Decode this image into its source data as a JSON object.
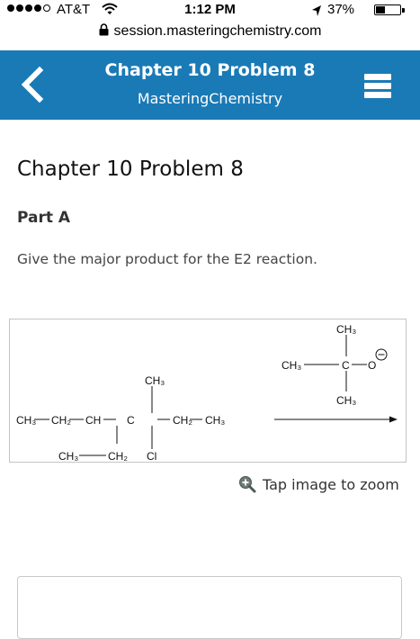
{
  "status_bar": {
    "carrier": "AT&T",
    "time": "1:12 PM",
    "battery_percent": "37%",
    "battery_level": 0.37
  },
  "browser": {
    "url": "session.masteringchemistry.com"
  },
  "app_header": {
    "title": "Chapter 10 Problem 8",
    "subtitle": "MasteringChemistry",
    "back_icon": "chevron-left-icon",
    "menu_icon": "hamburger-menu-icon",
    "background_color": "#1a7ab6"
  },
  "content": {
    "page_title": "Chapter 10 Problem 8",
    "part_label": "Part A",
    "question": "Give the major product for the E2 reaction.",
    "zoom_label": "Tap image to zoom"
  },
  "figure": {
    "substrate": {
      "ch3_top": "CH3",
      "main_chain": [
        "CH3",
        "CH2",
        "CH",
        "C",
        "CH2",
        "CH3"
      ],
      "branch_left": [
        "CH3",
        "CH2"
      ],
      "chlorine": "Cl"
    },
    "reagent": {
      "ch3_top": "CH3",
      "ch3_left": "CH3",
      "center": "C",
      "oxygen": "O",
      "charge": "−",
      "ch3_bottom": "CH3"
    }
  }
}
